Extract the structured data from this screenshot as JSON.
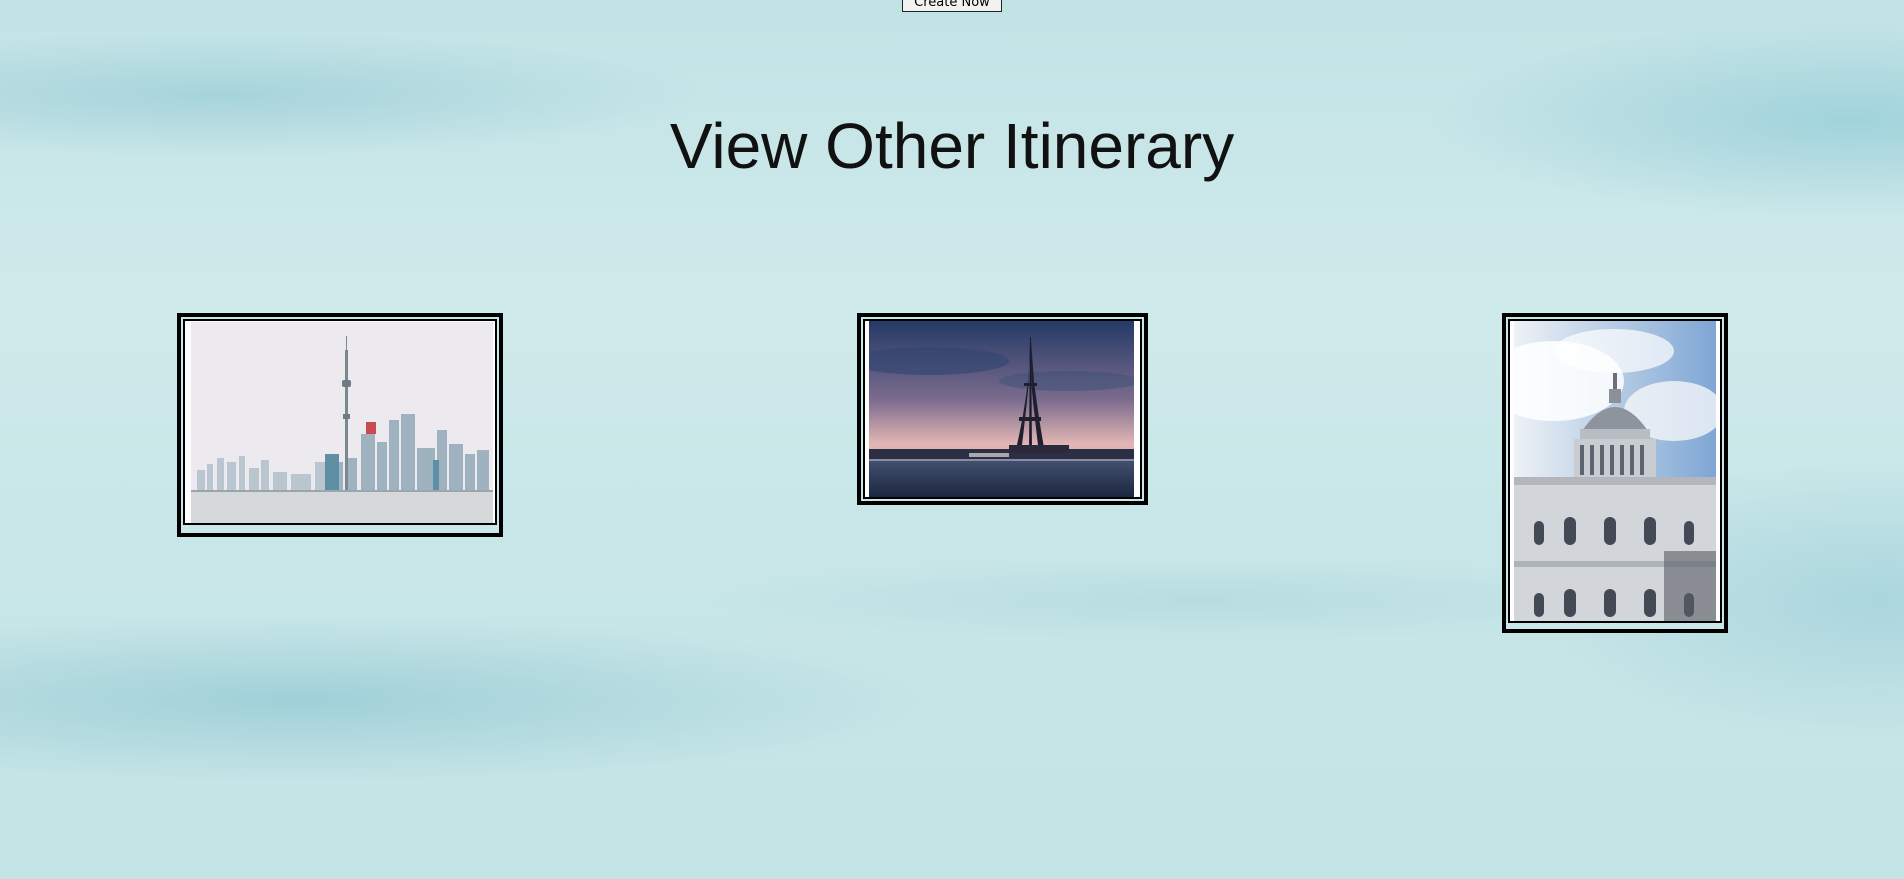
{
  "header": {
    "create_button_label": "Create Now"
  },
  "section": {
    "title": "View Other Itinerary"
  },
  "itineraries": [
    {
      "image": "toronto-skyline-cn-tower"
    },
    {
      "image": "paris-eiffel-tower-sunset"
    },
    {
      "image": "london-st-pauls-cathedral"
    }
  ],
  "colors": {
    "background": "#c9e7e9",
    "frame": "#000000",
    "title": "#111111"
  }
}
